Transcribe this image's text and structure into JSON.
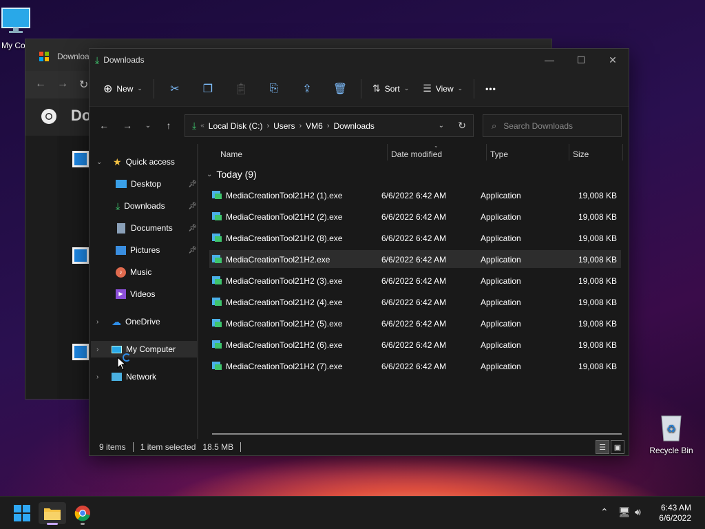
{
  "desktop": {
    "icons": [
      {
        "label": "My Co"
      },
      {
        "label": "Recycle Bin"
      }
    ]
  },
  "bg_window": {
    "title": "Downloa",
    "heading": "Do"
  },
  "window": {
    "title": "Downloads",
    "controls": {
      "minimize": "—",
      "maximize": "☐",
      "close": "✕"
    }
  },
  "commandbar": {
    "new_label": "New",
    "sort_label": "Sort",
    "view_label": "View",
    "more_label": "•••"
  },
  "address": {
    "crumbs": [
      "Local Disk (C:)",
      "Users",
      "VM6",
      "Downloads"
    ],
    "search_placeholder": "Search Downloads"
  },
  "nav": {
    "quick_access": "Quick access",
    "items": [
      {
        "label": "Desktop",
        "pinned": true
      },
      {
        "label": "Downloads",
        "pinned": true
      },
      {
        "label": "Documents",
        "pinned": true
      },
      {
        "label": "Pictures",
        "pinned": true
      },
      {
        "label": "Music",
        "pinned": false
      },
      {
        "label": "Videos",
        "pinned": false
      }
    ],
    "onedrive": "OneDrive",
    "mycomputer": "My Computer",
    "network": "Network"
  },
  "columns": {
    "name": "Name",
    "date": "Date modified",
    "type": "Type",
    "size": "Size"
  },
  "group_label": "Today (9)",
  "files": [
    {
      "name": "MediaCreationTool21H2 (1).exe",
      "date": "6/6/2022 6:42 AM",
      "type": "Application",
      "size": "19,008 KB",
      "selected": false
    },
    {
      "name": "MediaCreationTool21H2 (2).exe",
      "date": "6/6/2022 6:42 AM",
      "type": "Application",
      "size": "19,008 KB",
      "selected": false
    },
    {
      "name": "MediaCreationTool21H2 (8).exe",
      "date": "6/6/2022 6:42 AM",
      "type": "Application",
      "size": "19,008 KB",
      "selected": false
    },
    {
      "name": "MediaCreationTool21H2.exe",
      "date": "6/6/2022 6:42 AM",
      "type": "Application",
      "size": "19,008 KB",
      "selected": true
    },
    {
      "name": "MediaCreationTool21H2 (3).exe",
      "date": "6/6/2022 6:42 AM",
      "type": "Application",
      "size": "19,008 KB",
      "selected": false
    },
    {
      "name": "MediaCreationTool21H2 (4).exe",
      "date": "6/6/2022 6:42 AM",
      "type": "Application",
      "size": "19,008 KB",
      "selected": false
    },
    {
      "name": "MediaCreationTool21H2 (5).exe",
      "date": "6/6/2022 6:42 AM",
      "type": "Application",
      "size": "19,008 KB",
      "selected": false
    },
    {
      "name": "MediaCreationTool21H2 (6).exe",
      "date": "6/6/2022 6:42 AM",
      "type": "Application",
      "size": "19,008 KB",
      "selected": false
    },
    {
      "name": "MediaCreationTool21H2 (7).exe",
      "date": "6/6/2022 6:42 AM",
      "type": "Application",
      "size": "19,008 KB",
      "selected": false
    }
  ],
  "status": {
    "items": "9 items",
    "selection": "1 item selected",
    "size": "18.5 MB"
  },
  "taskbar": {
    "time": "6:43 AM",
    "date": "6/6/2022"
  },
  "colors": {
    "accent": "#0078d4",
    "folder": "#f5c243",
    "download_green": "#3ec46d"
  }
}
